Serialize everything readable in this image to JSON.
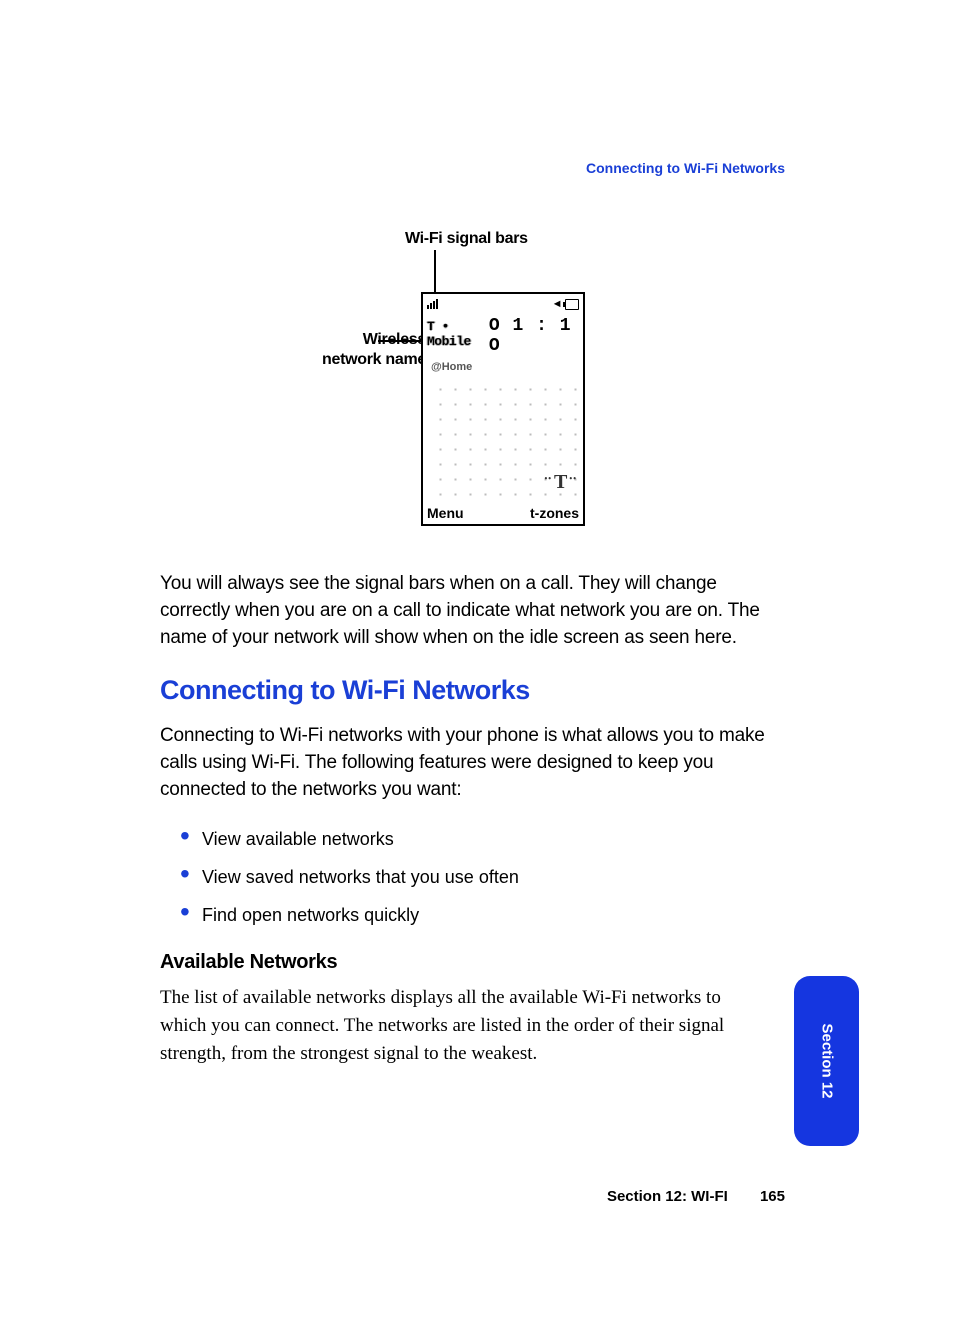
{
  "header_link": "Connecting to Wi-Fi Networks",
  "figure": {
    "wifi_bars_label": "Wi-Fi signal bars",
    "wireless_label_line1": "Wireless",
    "wireless_label_line2": "network name",
    "phone": {
      "carrier": "T • Mobile",
      "time": "O 1 : 1 O",
      "network_name": "@Home",
      "softkey_left": "Menu",
      "softkey_right": "t-zones",
      "mute_glyph": "◄",
      "tlogo": "T"
    }
  },
  "para1": "You will always see the signal bars when on a call.  They will change correctly when you are on a call to indicate what network you are on. The name of your network will show when on the idle screen as seen here.",
  "h1": "Connecting to Wi-Fi Networks",
  "para2": "Connecting to Wi-Fi networks with your phone is what allows you to make calls using Wi-Fi.  The following features were designed to keep you connected to the networks you want:",
  "bullets": {
    "b1": "View available networks",
    "b2": "View saved networks that you use often",
    "b3": "Find open networks quickly"
  },
  "h2": "Available Networks",
  "para3": "The list of available networks displays all the available Wi-Fi networks to which you can connect. The networks are listed in the order of their signal strength, from the strongest signal to the weakest.",
  "footer_section": "Section 12: WI-FI",
  "footer_page": "165",
  "tab_label": "Section 12"
}
